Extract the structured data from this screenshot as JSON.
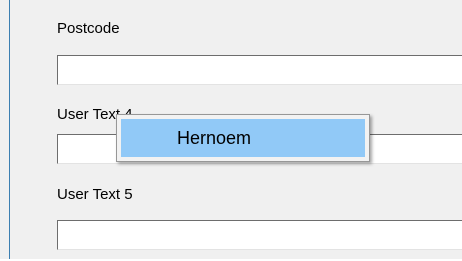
{
  "fields": [
    {
      "label": "Postcode",
      "value": "",
      "placeholder": ""
    },
    {
      "label": "User Text 4",
      "value": "",
      "placeholder": ""
    },
    {
      "label": "User Text 5",
      "value": "",
      "placeholder": ""
    }
  ],
  "context_menu": {
    "items": [
      {
        "label": "Hernoem",
        "highlighted": true
      }
    ]
  },
  "colors": {
    "panel_background": "#f0f0f0",
    "frame_border": "#3c7fb1",
    "menu_highlight": "#91c9f7"
  }
}
